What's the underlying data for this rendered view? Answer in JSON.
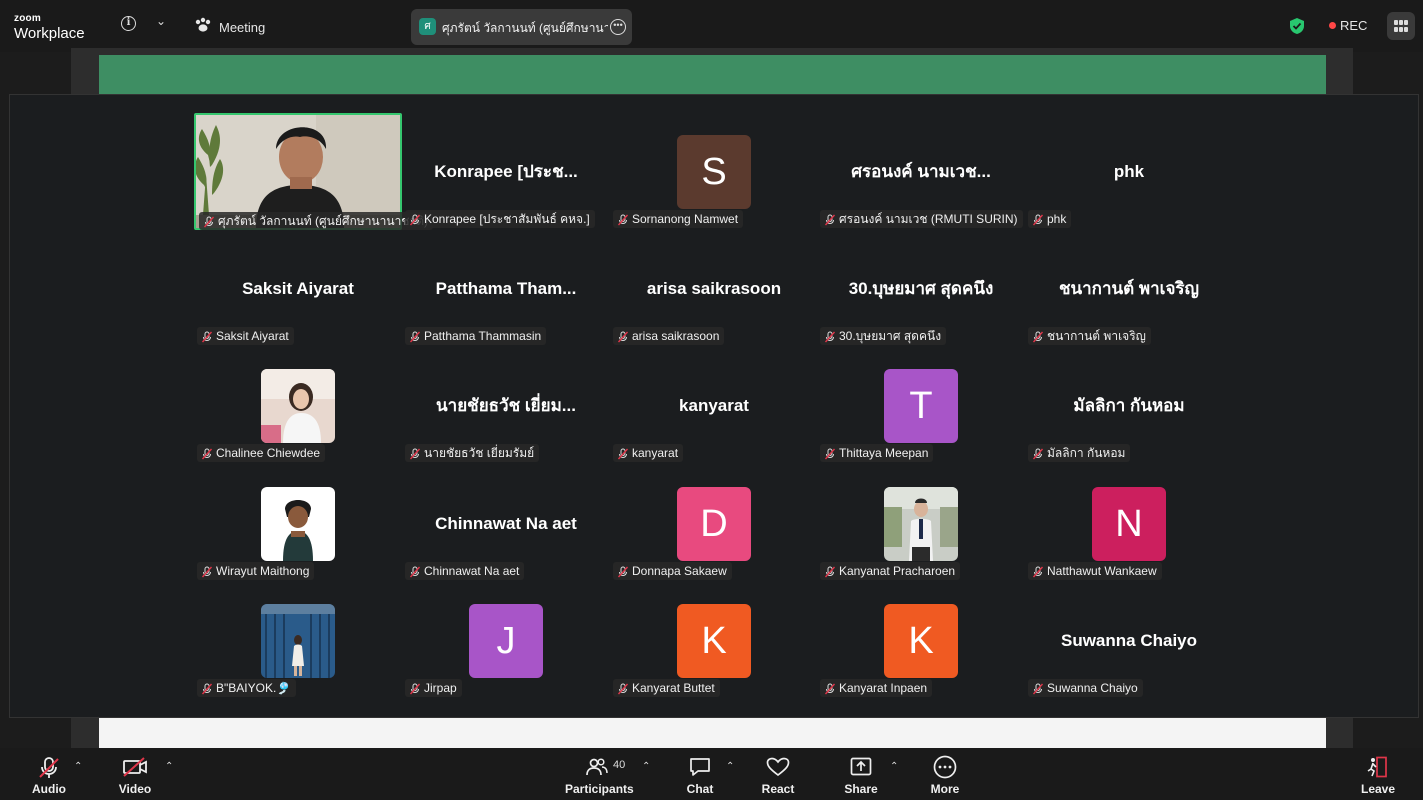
{
  "app": {
    "brand_line1": "zoom",
    "brand_line2": "Workplace",
    "meeting_label": "Meeting",
    "active_speaker": {
      "initial": "ศ",
      "name": "ศุภรัตน์ วัลกานนท์ (ศูนย์ศึกษานานา"
    },
    "rec_label": "REC",
    "rec_color": "#ff4747",
    "security_color": "#28c76f"
  },
  "participants": [
    {
      "display": "video",
      "label": "ศุภรัตน์ วัลกานนท์ (ศูนย์ศึกษานานาชาติ)",
      "active": true
    },
    {
      "display": "name",
      "big": "Konrapee [ประช...",
      "label": "Konrapee [ประชาสัมพันธ์ คหจ.]"
    },
    {
      "display": "initial",
      "initial": "S",
      "color": "#5b3a2e",
      "label": "Sornanong Namwet"
    },
    {
      "display": "name",
      "big": "ศรอนงค์ นามเวช...",
      "label": "ศรอนงค์ นามเวช (RMUTI SURIN)"
    },
    {
      "display": "name",
      "big": "phk",
      "label": "phk"
    },
    {
      "display": "name",
      "big": "Saksit Aiyarat",
      "label": "Saksit Aiyarat"
    },
    {
      "display": "name",
      "big": "Patthama  Tham...",
      "label": "Patthama Thammasin"
    },
    {
      "display": "name",
      "big": "arisa saikrasoon",
      "label": "arisa saikrasoon"
    },
    {
      "display": "name",
      "big": "30.บุษยมาศ สุดคนึง",
      "label": "30.บุษยมาศ สุดคนึง"
    },
    {
      "display": "name",
      "big": "ชนากานต์ พาเจริญ",
      "label": "ชนากานต์ พาเจริญ"
    },
    {
      "display": "photo",
      "photo": "girl-pink",
      "label": "Chalinee Chiewdee"
    },
    {
      "display": "name",
      "big": "นายชัยธวัช เยี่ยม...",
      "label": "นายชัยธวัช เยี่ยมรัมย์"
    },
    {
      "display": "name",
      "big": "kanyarat",
      "label": "kanyarat"
    },
    {
      "display": "initial",
      "initial": "T",
      "color": "#a855c8",
      "label": "Thittaya Meepan"
    },
    {
      "display": "name",
      "big": "มัลลิกา กันหอม",
      "label": "มัลลิกา กันหอม"
    },
    {
      "display": "photo",
      "photo": "cartoon",
      "label": "Wirayut Maithong"
    },
    {
      "display": "name",
      "big": "Chinnawat Na aet",
      "label": "Chinnawat Na aet"
    },
    {
      "display": "initial",
      "initial": "D",
      "color": "#e84a7f",
      "label": "Donnapa Sakaew"
    },
    {
      "display": "photo",
      "photo": "student",
      "label": "Kanyanat Pracharoen"
    },
    {
      "display": "initial",
      "initial": "N",
      "color": "#cc1f5e",
      "label": "Natthawut Wankaew"
    },
    {
      "display": "photo",
      "photo": "blue-door",
      "label": "B\"BAIYOK.🎐"
    },
    {
      "display": "initial",
      "initial": "J",
      "color": "#a855c8",
      "label": "Jirpap"
    },
    {
      "display": "initial",
      "initial": "K",
      "color": "#f05a22",
      "label": "Kanyarat Buttet"
    },
    {
      "display": "initial",
      "initial": "K",
      "color": "#f05a22",
      "label": "Kanyarat Inpaen"
    },
    {
      "display": "name",
      "big": "Suwanna Chaiyo",
      "label": "Suwanna Chaiyo"
    }
  ],
  "toolbar": {
    "audio": "Audio",
    "video": "Video",
    "participants": "Participants",
    "participants_count": "40",
    "chat": "Chat",
    "react": "React",
    "share": "Share",
    "more": "More",
    "leave": "Leave"
  }
}
